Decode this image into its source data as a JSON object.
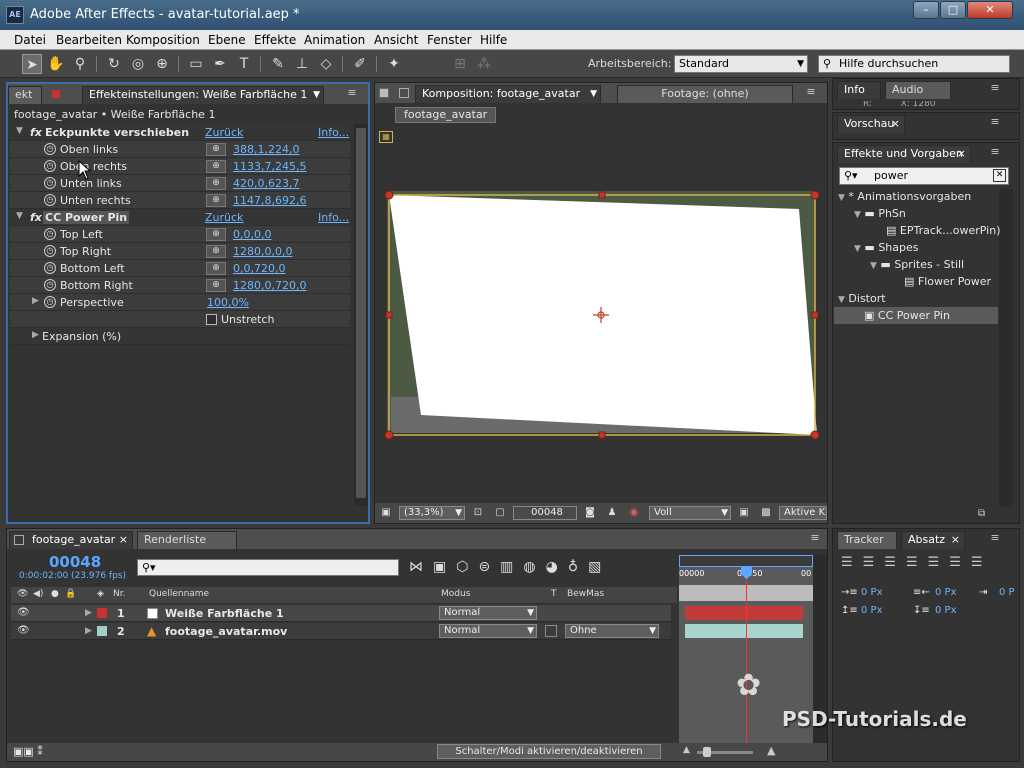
{
  "window": {
    "title": "Adobe After Effects - avatar-tutorial.aep *",
    "app_icon": "AE"
  },
  "menu": [
    "Datei",
    "Bearbeiten",
    "Komposition",
    "Ebene",
    "Effekte",
    "Animation",
    "Ansicht",
    "Fenster",
    "Hilfe"
  ],
  "toolbar": {
    "workspace_label": "Arbeitsbereich:",
    "workspace_value": "Standard",
    "search_placeholder": "Hilfe durchsuchen"
  },
  "effects_panel": {
    "tab_left": "ekt",
    "tab": "Effekteinstellungen: Weiße Farbfläche 1",
    "breadcrumb": "footage_avatar • Weiße Farbfläche 1",
    "fx1": {
      "name": "Eckpunkte verschieben",
      "reset": "Zurück",
      "info": "Info...",
      "params": [
        {
          "label": "Oben links",
          "value": "388,1,224,0"
        },
        {
          "label": "Oben rechts",
          "value": "1133,7,245,5"
        },
        {
          "label": "Unten links",
          "value": "420,0,623,7"
        },
        {
          "label": "Unten rechts",
          "value": "1147,8,692,6"
        }
      ]
    },
    "fx2": {
      "name": "CC Power Pin",
      "reset": "Zurück",
      "info": "Info...",
      "params": [
        {
          "label": "Top Left",
          "value": "0,0,0,0"
        },
        {
          "label": "Top Right",
          "value": "1280,0,0,0"
        },
        {
          "label": "Bottom Left",
          "value": "0,0,720,0"
        },
        {
          "label": "Bottom Right",
          "value": "1280,0,720,0"
        }
      ],
      "perspective_label": "Perspective",
      "perspective_value": "100,0%",
      "unstretch": "Unstretch"
    },
    "expansion": "Expansion (%)"
  },
  "comp_panel": {
    "tab": "Komposition: footage_avatar",
    "footage_tab": "Footage: (ohne)",
    "comp_name": "footage_avatar",
    "zoom": "(33,3%)",
    "frame": "00048",
    "resolution": "Voll",
    "camera": "Aktive K"
  },
  "right_panels": {
    "info_tab": "Info",
    "audio_tab": "Audio",
    "info_partial": "R:          X: 1280",
    "preview_tab": "Vorschau",
    "effects_tab": "Effekte und Vorgaben",
    "search_value": "power",
    "tree": [
      {
        "label": "* Animationsvorgaben",
        "indent": 0,
        "type": "tri"
      },
      {
        "label": "PhSn",
        "indent": 1,
        "type": "folder"
      },
      {
        "label": "EPTrack...owerPin)",
        "indent": 3,
        "type": "file"
      },
      {
        "label": "Shapes",
        "indent": 1,
        "type": "folder"
      },
      {
        "label": "Sprites - Still",
        "indent": 2,
        "type": "folder"
      },
      {
        "label": "Flower Power",
        "indent": 3,
        "type": "file"
      },
      {
        "label": "Distort",
        "indent": 0,
        "type": "tri"
      },
      {
        "label": "CC Power Pin",
        "indent": 2,
        "type": "file"
      }
    ]
  },
  "timeline": {
    "tab": "footage_avatar",
    "render_tab": "Renderliste",
    "timecode": "00048",
    "timecode_sub": "0:00:02:00 (23.976 fps)",
    "col_nr": "Nr.",
    "col_source": "Quellenname",
    "col_mode": "Modus",
    "col_t": "T",
    "col_bewmas": "BewMas",
    "layers": [
      {
        "nr": "1",
        "name": "Weiße Farbfläche 1",
        "mode": "Normal",
        "color": "#c83232"
      },
      {
        "nr": "2",
        "name": "footage_avatar.mov",
        "mode": "Normal",
        "bewmas": "Ohne",
        "color": "#9ecfc8"
      }
    ],
    "ruler_start": "00000",
    "ruler_mid": "00050",
    "ruler_end": "00",
    "footer_button": "Schalter/Modi aktivieren/deaktivieren"
  },
  "tracker_panel": {
    "tracker_tab": "Tracker",
    "absatz_tab": "Absatz",
    "px_values": [
      "0 Px",
      "0 Px",
      "0 P",
      "0 Px",
      "0 Px"
    ]
  },
  "watermark": "PSD-Tutorials.de"
}
